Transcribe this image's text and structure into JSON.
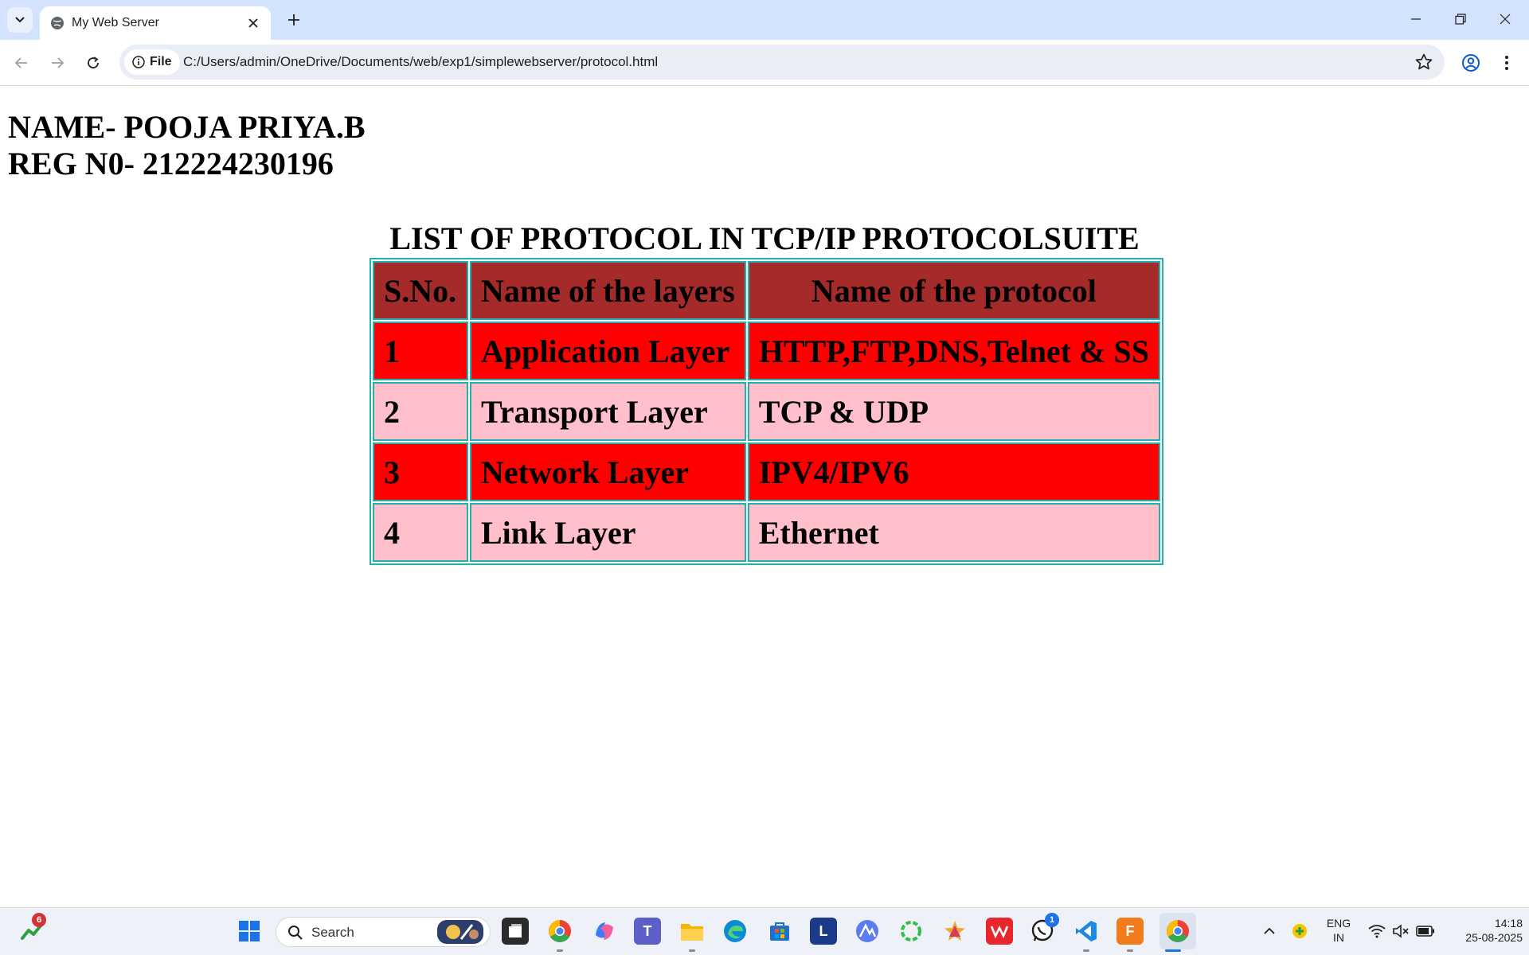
{
  "browser": {
    "tab_title": "My Web Server",
    "chip_label": "File",
    "url": "C:/Users/admin/OneDrive/Documents/web/exp1/simplewebserver/protocol.html"
  },
  "page": {
    "name_line": "NAME- POOJA PRIYA.B",
    "reg_line": "REG N0- 212224230196",
    "caption": "LIST OF PROTOCOL IN TCP/IP PROTOCOLSUITE",
    "headers": [
      "S.No.",
      "Name of the layers",
      "Name of the protocol"
    ],
    "rows": [
      {
        "sno": "1",
        "layer": "Application Layer",
        "protocol": "HTTP,FTP,DNS,Telnet & SS",
        "color": "#ff0000"
      },
      {
        "sno": "2",
        "layer": "Transport Layer",
        "protocol": "TCP & UDP",
        "color": "#ffc0cb"
      },
      {
        "sno": "3",
        "layer": "Network Layer",
        "protocol": "IPV4/IPV6",
        "color": "#ff0000"
      },
      {
        "sno": "4",
        "layer": "Link Layer",
        "protocol": "Ethernet",
        "color": "#ffc0cb"
      }
    ],
    "header_color": "#a52a2a",
    "border_color": "#20b2aa"
  },
  "taskbar": {
    "search_label": "Search",
    "stocks_badge": "6",
    "whatsapp_badge": "1",
    "lang_top": "ENG",
    "lang_bottom": "IN",
    "time": "14:18",
    "date": "25-08-2025"
  }
}
